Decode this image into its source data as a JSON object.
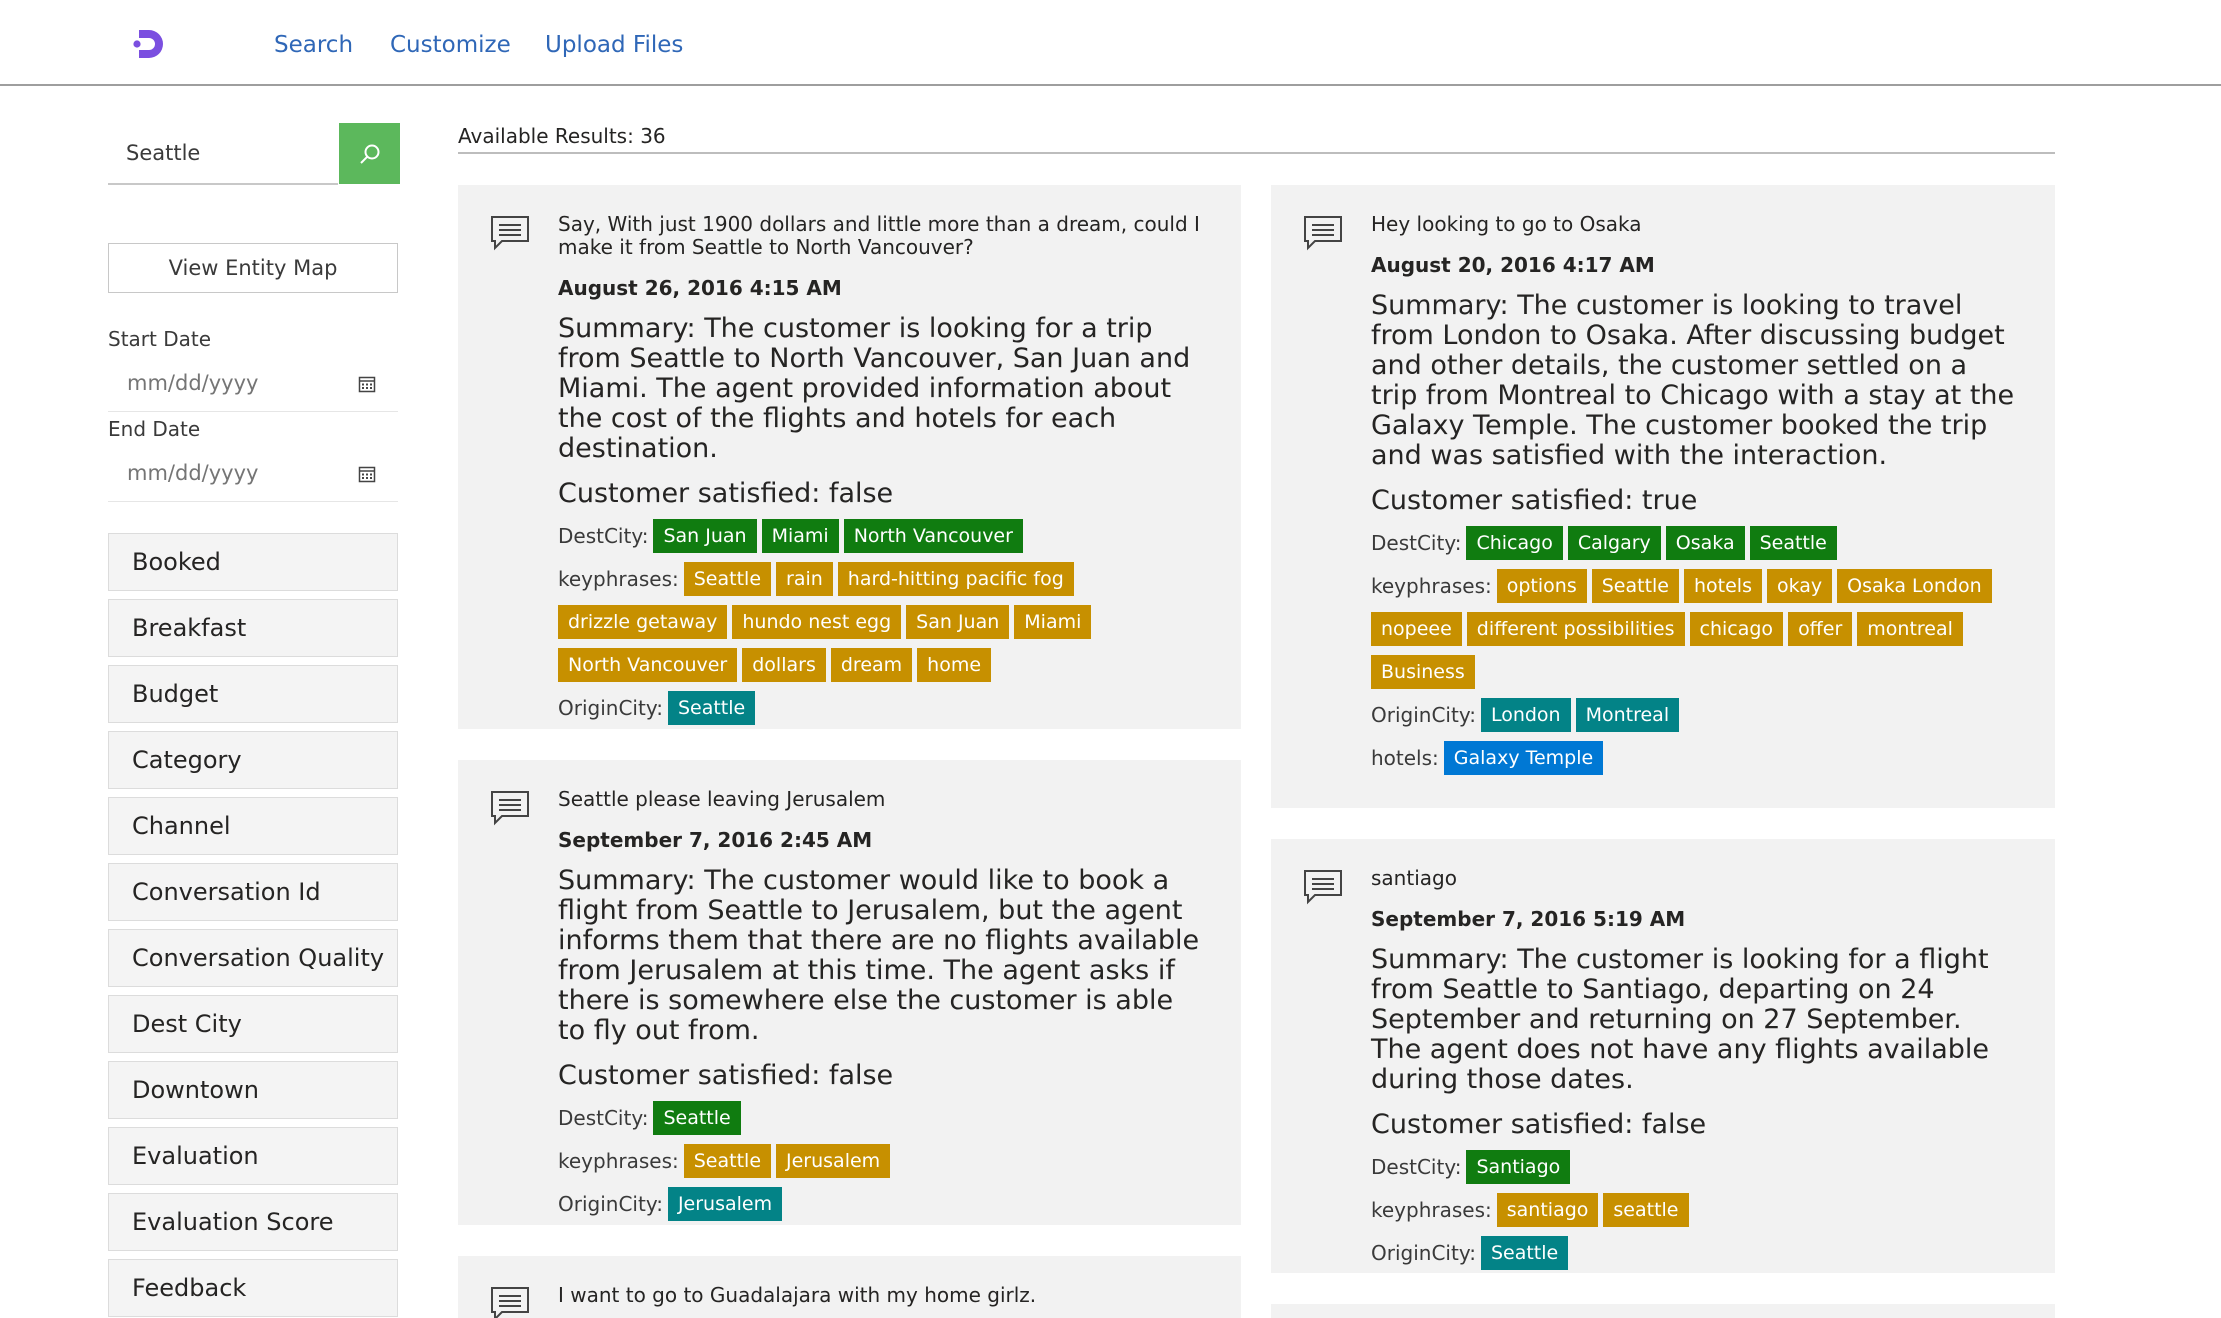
{
  "nav": {
    "search": "Search",
    "customize": "Customize",
    "upload": "Upload Files"
  },
  "sidebar": {
    "search_value": "Seattle",
    "view_entity_map": "View Entity Map",
    "start_date_label": "Start Date",
    "end_date_label": "End Date",
    "date_placeholder": "mm/dd/yyyy",
    "facets": [
      "Booked",
      "Breakfast",
      "Budget",
      "Category",
      "Channel",
      "Conversation Id",
      "Conversation Quality",
      "Dest City",
      "Downtown",
      "Evaluation",
      "Evaluation Score",
      "Feedback"
    ]
  },
  "results": {
    "label": "Available Results: 36"
  },
  "cards": [
    {
      "question": "Say, With just 1900 dollars and little more than a dream, could I make it from Seattle to North Vancouver?",
      "timestamp": "August 26, 2016 4:15 AM",
      "summary": "Summary: The customer is looking for a trip from Seattle to North Vancouver, San Juan and Miami. The agent provided information about the cost of the flights and hotels for each destination.",
      "satisfied": "Customer satisfied: false",
      "dest_label": "DestCity:",
      "dest": [
        "San Juan",
        "Miami",
        "North Vancouver"
      ],
      "kp_label": "keyphrases:",
      "keyphrases": [
        "Seattle",
        "rain",
        "hard-hitting pacific fog",
        "drizzle getaway",
        "hundo nest egg",
        "San Juan",
        "Miami",
        "North Vancouver",
        "dollars",
        "dream",
        "home"
      ],
      "origin_label": "OriginCity:",
      "origin": [
        "Seattle"
      ]
    },
    {
      "question": "Seattle please leaving Jerusalem",
      "timestamp": "September 7, 2016 2:45 AM",
      "summary": "Summary: The customer would like to book a flight from Seattle to Jerusalem, but the agent informs them that there are no flights available from Jerusalem at this time. The agent asks if there is somewhere else the customer is able to fly out from.",
      "satisfied": "Customer satisfied: false",
      "dest_label": "DestCity:",
      "dest": [
        "Seattle"
      ],
      "kp_label": "keyphrases:",
      "keyphrases": [
        "Seattle",
        "Jerusalem"
      ],
      "origin_label": "OriginCity:",
      "origin": [
        "Jerusalem"
      ]
    },
    {
      "question": "I want to go to Guadalajara with my home girlz."
    },
    {
      "question": "Hey looking to go to Osaka",
      "timestamp": "August 20, 2016 4:17 AM",
      "summary": "Summary: The customer is looking to travel from London to Osaka. After discussing budget and other details, the customer settled on a trip from Montreal to Chicago with a stay at the Galaxy Temple. The customer booked the trip and was satisfied with the interaction.",
      "satisfied": "Customer satisfied: true",
      "dest_label": "DestCity:",
      "dest": [
        "Chicago",
        "Calgary",
        "Osaka",
        "Seattle"
      ],
      "kp_label": "keyphrases:",
      "keyphrases": [
        "options",
        "Seattle",
        "hotels",
        "okay",
        "Osaka London",
        "nopeee",
        "different possibilities",
        "chicago",
        "offer",
        "montreal",
        "Business"
      ],
      "origin_label": "OriginCity:",
      "origin": [
        "London",
        "Montreal"
      ],
      "hotels_label": "hotels:",
      "hotels": [
        "Galaxy Temple"
      ]
    },
    {
      "question": "santiago",
      "timestamp": "September 7, 2016 5:19 AM",
      "summary": "Summary: The customer is looking for a flight from Seattle to Santiago, departing on 24 September and returning on 27 September. The agent does not have any flights available during those dates.",
      "satisfied": "Customer satisfied: false",
      "dest_label": "DestCity:",
      "dest": [
        "Santiago"
      ],
      "kp_label": "keyphrases:",
      "keyphrases": [
        "santiago",
        "seattle"
      ],
      "origin_label": "OriginCity:",
      "origin": [
        "Seattle"
      ]
    }
  ]
}
